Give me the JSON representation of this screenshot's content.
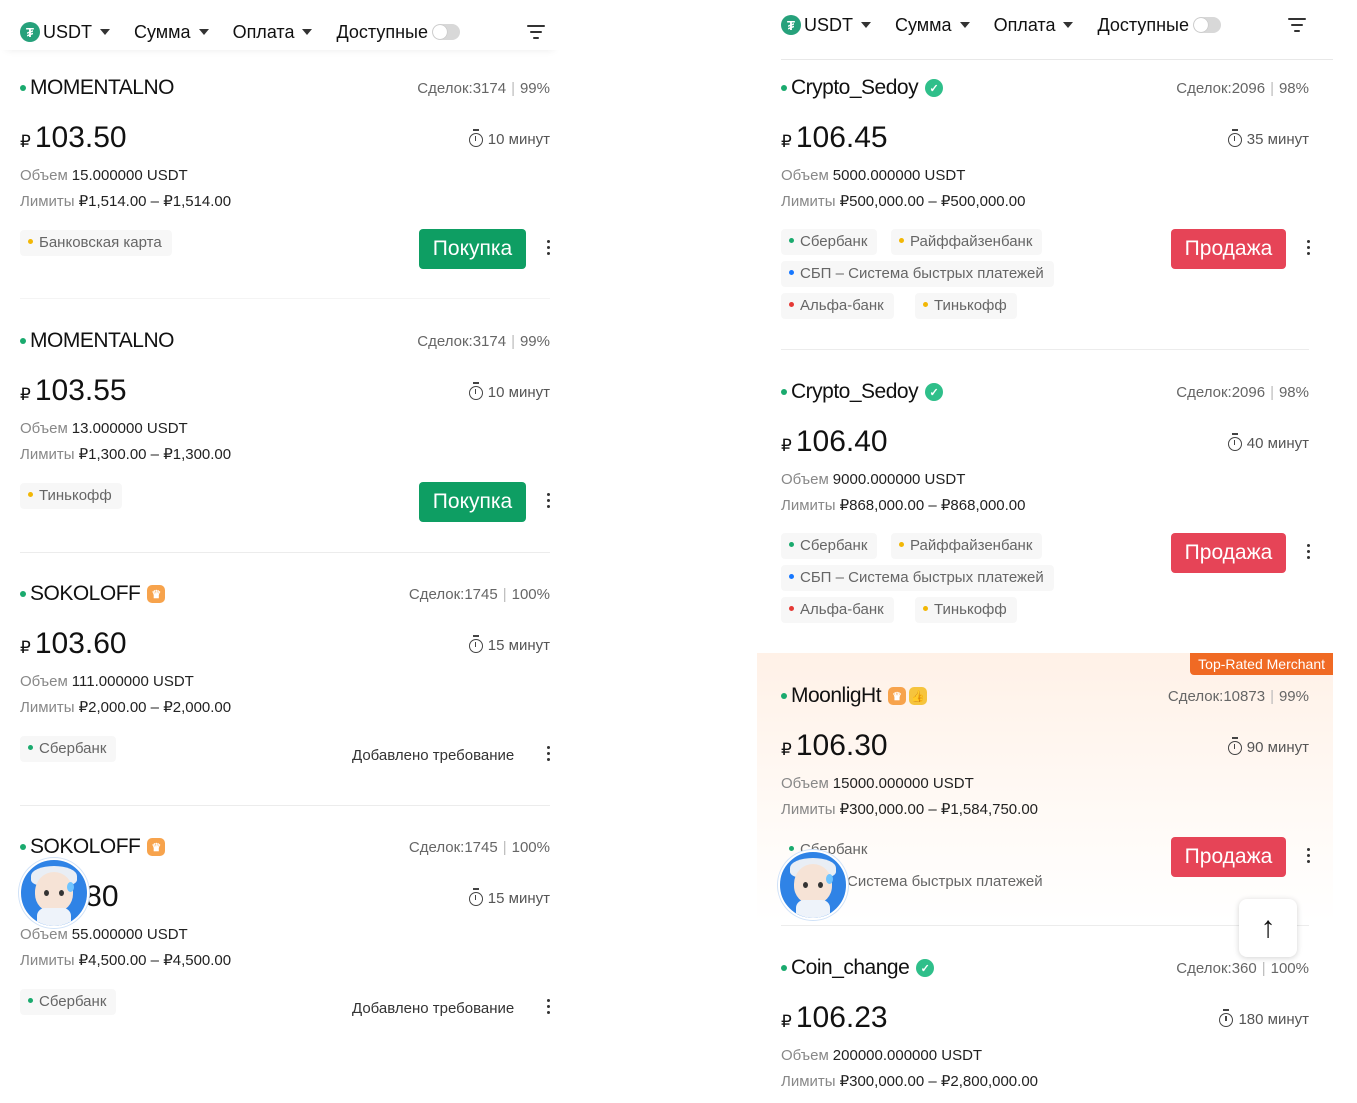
{
  "filters": {
    "currency": "USDT",
    "amount": "Сумма",
    "payment": "Оплата",
    "available": "Доступные",
    "available_on": false
  },
  "left_offers": [
    {
      "name": "MOMENTALNO",
      "deals": "Сделок:3174",
      "rate": "99%",
      "currency_symbol": "₽",
      "price": "103.50",
      "time": "10 минут",
      "volume_label": "Объем",
      "volume": "15.000000 USDT",
      "limits_label": "Лимиты",
      "limits": "₽1,514.00 – ₽1,514.00",
      "payments": [
        {
          "label": "Банковская карта",
          "color": "#f2b705"
        }
      ],
      "action": "Покупка"
    },
    {
      "name": "MOMENTALNO",
      "deals": "Сделок:3174",
      "rate": "99%",
      "currency_symbol": "₽",
      "price": "103.55",
      "time": "10 минут",
      "volume_label": "Объем",
      "volume": "13.000000 USDT",
      "limits_label": "Лимиты",
      "limits": "₽1,300.00 – ₽1,300.00",
      "payments": [
        {
          "label": "Тинькофф",
          "color": "#f2b705"
        }
      ],
      "action": "Покупка"
    },
    {
      "name": "SOKOLOFF",
      "deals": "Сделок:1745",
      "rate": "100%",
      "currency_symbol": "₽",
      "price": "103.60",
      "time": "15 минут",
      "volume_label": "Объем",
      "volume": "111.000000 USDT",
      "limits_label": "Лимиты",
      "limits": "₽2,000.00 – ₽2,000.00",
      "payments": [
        {
          "label": "Сбербанк",
          "color": "#1aaa6e"
        }
      ],
      "requirement": "Добавлено требование"
    },
    {
      "name": "SOKOLOFF",
      "deals": "Сделок:1745",
      "rate": "100%",
      "currency_symbol": "₽",
      "price": ".80",
      "time": "15 минут",
      "volume_label": "Объем",
      "volume": "55.000000 USDT",
      "limits_label": "Лимиты",
      "limits": "₽4,500.00 – ₽4,500.00",
      "payments": [
        {
          "label": "Сбербанк",
          "color": "#1aaa6e"
        }
      ],
      "requirement": "Добавлено требование"
    }
  ],
  "right_offers": [
    {
      "name": "Crypto_Sedoy",
      "deals": "Сделок:2096",
      "rate": "98%",
      "currency_symbol": "₽",
      "price": "106.45",
      "time": "35 минут",
      "volume_label": "Объем",
      "volume": "5000.000000 USDT",
      "limits_label": "Лимиты",
      "limits": "₽500,000.00 – ₽500,000.00",
      "payments": [
        {
          "label": "Сбербанк",
          "color": "#1aaa6e"
        },
        {
          "label": "Райффайзенбанк",
          "color": "#f2b705"
        },
        {
          "label": "СБП – Система быстрых платежей",
          "color": "#1677ff"
        },
        {
          "label": "Альфа-банк",
          "color": "#e53935"
        },
        {
          "label": "Тинькофф",
          "color": "#f2b705"
        }
      ],
      "action": "Продажа"
    },
    {
      "name": "Crypto_Sedoy",
      "deals": "Сделок:2096",
      "rate": "98%",
      "currency_symbol": "₽",
      "price": "106.40",
      "time": "40 минут",
      "volume_label": "Объем",
      "volume": "9000.000000 USDT",
      "limits_label": "Лимиты",
      "limits": "₽868,000.00 – ₽868,000.00",
      "payments": [
        {
          "label": "Сбербанк",
          "color": "#1aaa6e"
        },
        {
          "label": "Райффайзенбанк",
          "color": "#f2b705"
        },
        {
          "label": "СБП – Система быстрых платежей",
          "color": "#1677ff"
        },
        {
          "label": "Альфа-банк",
          "color": "#e53935"
        },
        {
          "label": "Тинькофф",
          "color": "#f2b705"
        }
      ],
      "action": "Продажа"
    },
    {
      "name": "MoonligHt",
      "deals": "Сделок:10873",
      "rate": "99%",
      "currency_symbol": "₽",
      "price": "106.30",
      "time": "90 минут",
      "volume_label": "Объем",
      "volume": "15000.000000 USDT",
      "limits_label": "Лимиты",
      "limits": "₽300,000.00 – ₽1,584,750.00",
      "payments": [
        {
          "label": "Сбербанк",
          "color": "#1aaa6e"
        },
        {
          "label": "Система быстрых платежей",
          "color": "#1677ff"
        }
      ],
      "action": "Продажа",
      "top_rated": "Top-Rated Merchant"
    },
    {
      "name": "Coin_change",
      "deals": "Сделок:360",
      "rate": "100%",
      "currency_symbol": "₽",
      "price": "106.23",
      "time": "180 минут",
      "volume_label": "Объем",
      "volume": "200000.000000 USDT",
      "limits_label": "Лимиты",
      "limits": "₽300,000.00 – ₽2,800,000.00"
    }
  ],
  "colors": {
    "buy": "#0e9e63",
    "sell": "#e64457",
    "online": "#1aaa6e",
    "top_rated": "#f06a24"
  }
}
